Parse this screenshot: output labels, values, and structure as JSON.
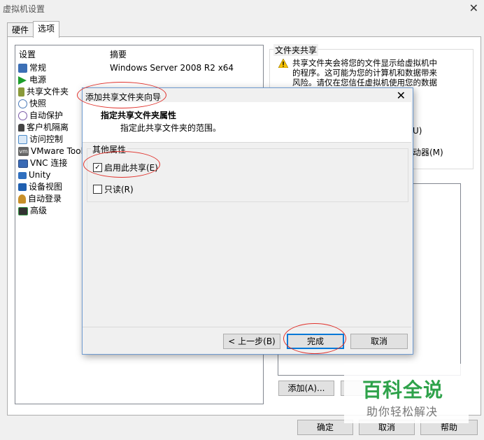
{
  "window": {
    "title": "虚拟机设置",
    "close": "✕"
  },
  "tabs": [
    {
      "label": "硬件"
    },
    {
      "label": "选项"
    }
  ],
  "settings": {
    "header_setting": "设置",
    "header_summary": "摘要",
    "items": [
      {
        "label": "常规",
        "icon": "general-icon",
        "color": "#3c6fb5"
      },
      {
        "label": "电源",
        "icon": "power-icon",
        "color": "#1e9e2c"
      },
      {
        "label": "共享文件夹",
        "icon": "shared-folder-icon",
        "color": "#8a9a3a"
      },
      {
        "label": "快照",
        "icon": "snapshot-icon",
        "color": "#4a7ab8"
      },
      {
        "label": "自动保护",
        "icon": "autoprotect-icon",
        "color": "#7a5aa8"
      },
      {
        "label": "客户机隔离",
        "icon": "lock-icon",
        "color": "#444444"
      },
      {
        "label": "访问控制",
        "icon": "access-control-icon",
        "color": "#4a8ac8"
      },
      {
        "label": "VMware Tools",
        "icon": "vmware-icon",
        "color": "#666666"
      },
      {
        "label": "VNC 连接",
        "icon": "vnc-icon",
        "color": "#3a6ab5"
      },
      {
        "label": "Unity",
        "icon": "unity-icon",
        "color": "#2f6fbf"
      },
      {
        "label": "设备视图",
        "icon": "device-view-icon",
        "color": "#1f5fb0"
      },
      {
        "label": "自动登录",
        "icon": "autologin-icon",
        "color": "#c8902a"
      },
      {
        "label": "高级",
        "icon": "advanced-icon",
        "color": "#3a9a4a"
      }
    ],
    "summary_general": "Windows Server 2008 R2 x64"
  },
  "shared_folders": {
    "group_title": "文件夹共享",
    "warning_lines": [
      "共享文件夹会将您的文件显示给虚拟机中",
      "的程序。这可能为您的计算机和数据带来",
      "风险。请仅在您信任虚拟机使用您的数据"
    ],
    "partial_option_1": "U)",
    "partial_option_2": "动器(M)",
    "add_button": "添加(A)..."
  },
  "footer": {
    "ok": "确定",
    "cancel": "取消",
    "help": "帮助"
  },
  "dialog": {
    "title": "添加共享文件夹向导",
    "close": "✕",
    "heading": "指定共享文件夹属性",
    "subheading": "指定此共享文件夹的范围。",
    "group_title": "其他属性",
    "enable_share": {
      "label": "启用此共享(E)",
      "checked": true,
      "mark": "✓"
    },
    "read_only": {
      "label": "只读(R)",
      "checked": false
    },
    "back_button": "< 上一步(B)",
    "finish_button": "完成",
    "cancel_button": "取消"
  },
  "watermark": {
    "title": "百科全说",
    "subtitle": "助你轻松解决"
  },
  "colors": {
    "accent": "#0078d7",
    "annotation": "#e0312b",
    "watermark": "#2ea24a"
  }
}
